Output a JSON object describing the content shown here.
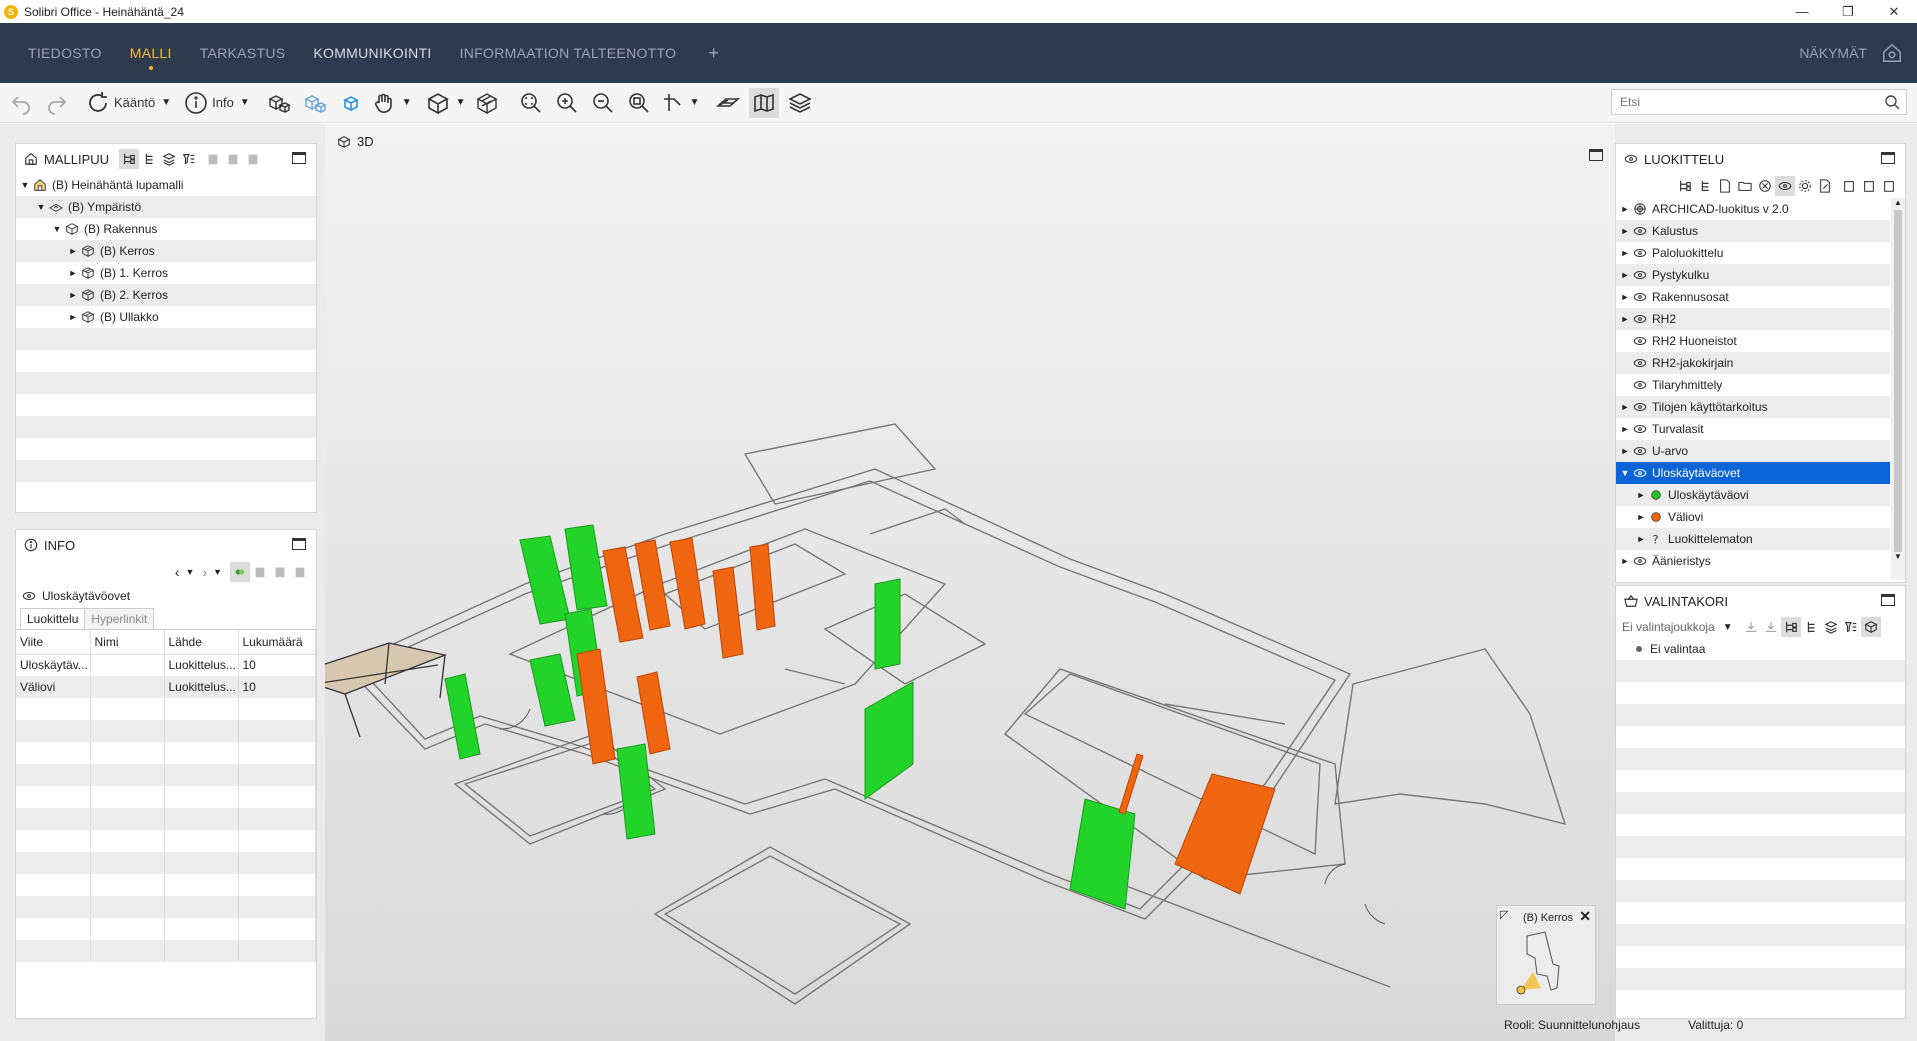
{
  "window": {
    "title": "Solibri Office - Heinähäntä_24",
    "logo_letter": "S",
    "minimize": "—",
    "restore": "❐",
    "close": "✕"
  },
  "menu": {
    "items": [
      "TIEDOSTO",
      "MALLI",
      "TARKASTUS",
      "KOMMUNIKOINTI",
      "INFORMAATION TALTEENOTTO"
    ],
    "active_index": 1,
    "plus": "+",
    "views_label": "NÄKYMÄT",
    "accent_color": "#f0b93a",
    "bg_color": "#2f3a4c"
  },
  "toolbar": {
    "rotate_label": "Kääntö",
    "info_label": "Info",
    "search_placeholder": "Etsi"
  },
  "model_tree": {
    "title": "MALLIPUU",
    "rows": [
      {
        "label": "(B) Heinähäntä lupamalli",
        "twisty": "▼",
        "icon": "model-icon",
        "indent": 0
      },
      {
        "label": "(B) Ympäristö",
        "twisty": "▼",
        "icon": "site-icon",
        "indent": 1
      },
      {
        "label": "(B) Rakennus",
        "twisty": "▼",
        "icon": "building-icon",
        "indent": 2
      },
      {
        "label": "(B) Kerros",
        "twisty": "►",
        "icon": "storey-icon",
        "indent": 3
      },
      {
        "label": "(B) 1. Kerros",
        "twisty": "►",
        "icon": "storey-icon",
        "indent": 3
      },
      {
        "label": "(B) 2. Kerros",
        "twisty": "►",
        "icon": "storey-icon",
        "indent": 3
      },
      {
        "label": "(B) Ullakko",
        "twisty": "►",
        "icon": "storey-icon",
        "indent": 3
      }
    ]
  },
  "info": {
    "title": "INFO",
    "selected_item": "Uloskäytävöovet",
    "tabs": [
      "Luokittelu",
      "Hyperlinkit"
    ],
    "columns": [
      "Viite",
      "Nimi",
      "Lähde",
      "Lukumäärä"
    ],
    "rows": [
      [
        "Uloskäytäv...",
        "",
        "Luokittelus...",
        "10"
      ],
      [
        "Väliovi",
        "",
        "Luokittelus...",
        "10"
      ]
    ]
  },
  "viewport": {
    "label": "3D",
    "minimap_label": "(B) Kerros",
    "minimap_close": "✕",
    "minimap_expand": "◸",
    "door_green": "#22d42a",
    "door_orange": "#f0650f"
  },
  "classifier": {
    "title": "LUOKITTELU",
    "rows": [
      {
        "label": "ARCHICAD-luokitus v 2.0",
        "twisty": "►",
        "icon": "classification-icon"
      },
      {
        "label": "Kalustus",
        "twisty": "►",
        "icon": "eye-icon"
      },
      {
        "label": "Paloluokittelu",
        "twisty": "►",
        "icon": "eye-icon"
      },
      {
        "label": "Pystykulku",
        "twisty": "►",
        "icon": "eye-icon"
      },
      {
        "label": "Rakennusosat",
        "twisty": "►",
        "icon": "eye-icon"
      },
      {
        "label": "RH2",
        "twisty": "►",
        "icon": "eye-icon"
      },
      {
        "label": "RH2 Huoneistot",
        "twisty": "",
        "icon": "eye-icon"
      },
      {
        "label": "RH2-jakokirjain",
        "twisty": "",
        "icon": "eye-icon"
      },
      {
        "label": "Tilaryhmittely",
        "twisty": "",
        "icon": "eye-icon"
      },
      {
        "label": "Tilojen käyttötarkoitus",
        "twisty": "►",
        "icon": "eye-icon"
      },
      {
        "label": "Turvalasit",
        "twisty": "►",
        "icon": "eye-icon"
      },
      {
        "label": "U-arvo",
        "twisty": "►",
        "icon": "eye-icon"
      },
      {
        "label": "Uloskäytäväovet",
        "twisty": "▼",
        "icon": "eye-icon",
        "selected": true
      },
      {
        "label": "Uloskäytäväovi",
        "twisty": "►",
        "icon": "green-dot-icon",
        "child": true
      },
      {
        "label": "Väliovi",
        "twisty": "►",
        "icon": "orange-dot-icon",
        "child": true
      },
      {
        "label": "Luokittelematon",
        "twisty": "►",
        "icon": "question-icon",
        "child": true
      },
      {
        "label": "Äänieristys",
        "twisty": "►",
        "icon": "eye-icon"
      }
    ]
  },
  "selection_basket": {
    "title": "VALINTAKORI",
    "dropdown_label": "Ei valintajoukkoja",
    "items": [
      "Ei valintaa"
    ]
  },
  "status": {
    "role": "Rooli: Suunnittelunohjaus",
    "selected": "Valittuja: 0"
  }
}
